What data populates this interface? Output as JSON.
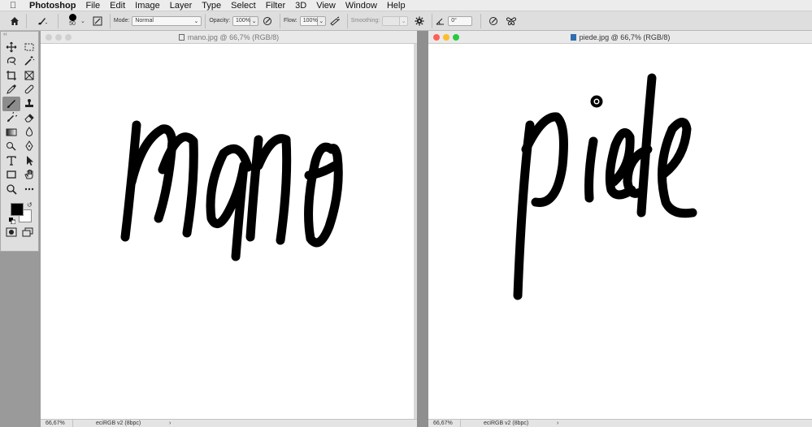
{
  "menubar": {
    "app_name": "Photoshop",
    "items": [
      "File",
      "Edit",
      "Image",
      "Layer",
      "Type",
      "Select",
      "Filter",
      "3D",
      "View",
      "Window",
      "Help"
    ]
  },
  "options_bar": {
    "brush_size": "50",
    "mode_label": "Mode:",
    "mode_value": "Normal",
    "opacity_label": "Opacity:",
    "opacity_value": "100%",
    "flow_label": "Flow:",
    "flow_value": "100%",
    "smoothing_label": "Smoothing:",
    "smoothing_value": "",
    "angle_value": "0°"
  },
  "tools_panel": {
    "collapse_label": "‹‹",
    "tools": [
      "move-tool-icon",
      "marquee-tool-icon",
      "lasso-tool-icon",
      "magic-wand-tool-icon",
      "crop-tool-icon",
      "frame-tool-icon",
      "eyedropper-tool-icon",
      "healing-brush-tool-icon",
      "brush-tool-icon",
      "clone-stamp-tool-icon",
      "history-brush-tool-icon",
      "eraser-tool-icon",
      "gradient-tool-icon",
      "blur-tool-icon",
      "dodge-tool-icon",
      "pen-tool-icon",
      "type-tool-icon",
      "path-selection-tool-icon",
      "rectangle-tool-icon",
      "hand-tool-icon",
      "zoom-tool-icon",
      "more-tools-icon"
    ],
    "foreground_color": "#000000",
    "background_color": "#ffffff"
  },
  "documents": [
    {
      "title": "mano.jpg @ 66,7% (RGB/8)",
      "zoom": "66,67%",
      "profile": "eciRGB v2 (8bpc)",
      "arrow": "›",
      "active": false
    },
    {
      "title": "piede.jpg @ 66,7% (RGB/8)",
      "zoom": "66,67%",
      "profile": "eciRGB v2 (8bpc)",
      "arrow": "›",
      "active": true
    }
  ],
  "colors": {
    "close": "#fe5f57",
    "minimize": "#febc2e",
    "maximize": "#28c840",
    "inactive_light": "#d0d0d0"
  }
}
